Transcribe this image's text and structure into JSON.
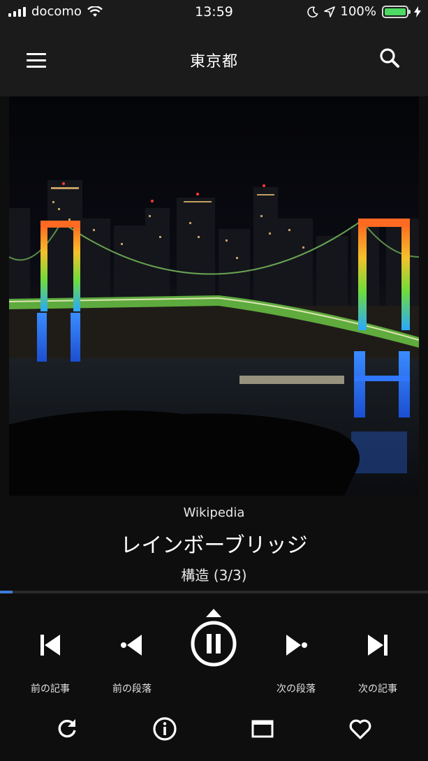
{
  "status_bar": {
    "carrier": "docomo",
    "time": "13:59",
    "battery_percent": "100%",
    "battery_level": 1.0,
    "icons": [
      "signal-icon",
      "wifi-icon",
      "moon-icon",
      "location-icon",
      "battery-icon",
      "charging-icon"
    ]
  },
  "header": {
    "title": "東京都",
    "menu_icon": "hamburger-menu-icon",
    "search_icon": "search-icon"
  },
  "article": {
    "source": "Wikipedia",
    "title": "レインボーブリッジ",
    "section": "構造 (3/3)"
  },
  "playback": {
    "progress": 0.03,
    "state": "playing"
  },
  "controls": {
    "prev_article": "前の記事",
    "prev_paragraph": "前の段落",
    "next_paragraph": "次の段落",
    "next_article": "次の記事"
  },
  "bottom_icons": [
    "refresh-icon",
    "info-icon",
    "window-icon",
    "heart-icon"
  ],
  "colors": {
    "accent": "#3d7bd9",
    "background": "#0e0e0f",
    "bar": "#1b1b1c"
  }
}
